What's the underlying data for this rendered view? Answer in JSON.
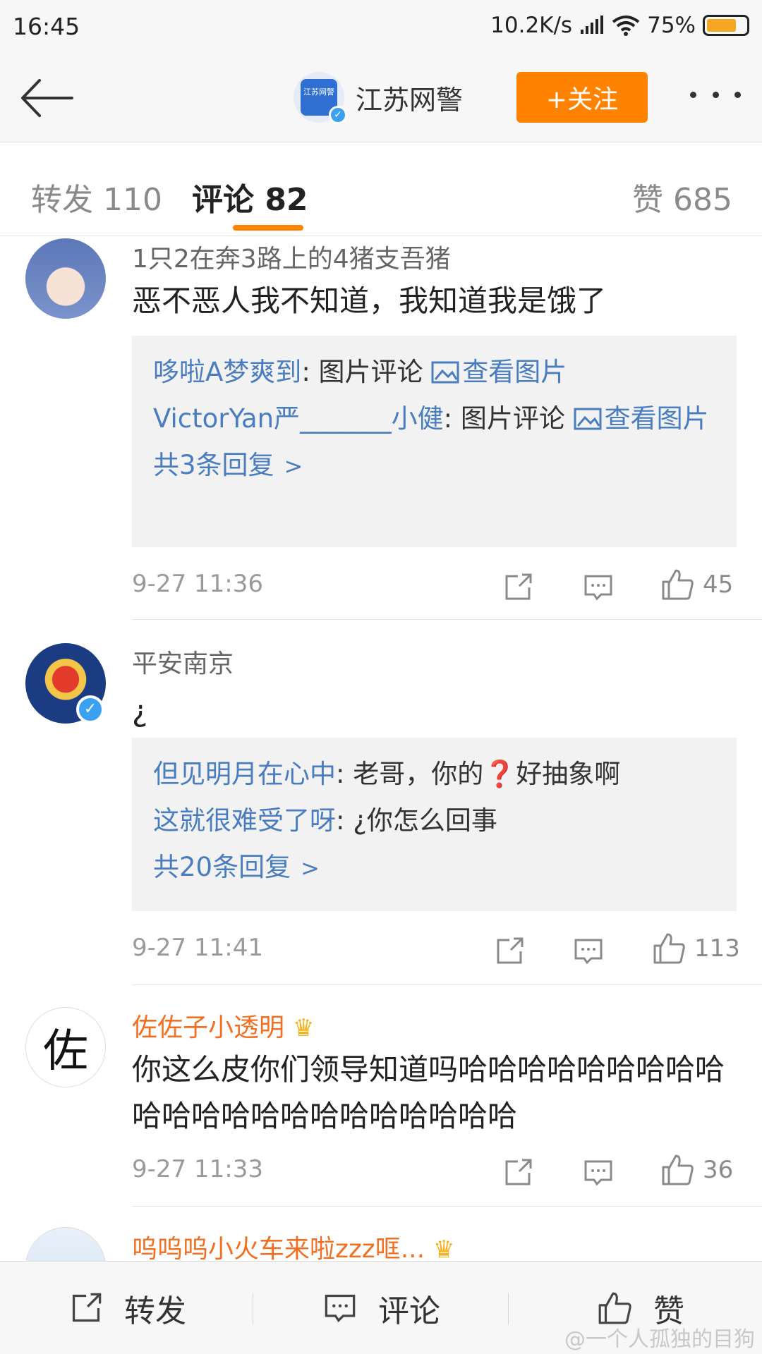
{
  "status_bar": {
    "time": "16:45",
    "network_speed": "10.2K/s",
    "battery": "75%",
    "icons": [
      "signal-icon",
      "wifi-icon",
      "battery-icon"
    ],
    "battery_level": 0.75
  },
  "header": {
    "account_name": "江苏网警",
    "avatar_text": "江苏网警",
    "follow_label": "+关注",
    "accent_color": "#ff8200"
  },
  "tabs": {
    "repost": "转发 110",
    "comment": "评论 82",
    "like": "赞 685"
  },
  "comments": [
    {
      "username": "1只2在奔3路上的4猪支吾猪",
      "content": "恶不恶人我不知道，我知道我是饿了",
      "replies": [
        {
          "user": "哆啦A梦爽到",
          "text": ": 图片评论 ",
          "link": "查看图片"
        },
        {
          "user": "VictorYan严_______小健",
          "text": ": 图片评论 ",
          "link": "查看图片"
        }
      ],
      "total_replies": "共3条回复",
      "time": "9-27 11:36",
      "likes": "45"
    },
    {
      "username": "平安南京",
      "content": "¿",
      "replies": [
        {
          "user": "但见明月在心中",
          "text": ": 老哥，你的❓好抽象啊"
        },
        {
          "user": "这就很难受了呀",
          "text": ": ¿你怎么回事"
        }
      ],
      "total_replies": "共20条回复",
      "time": "9-27 11:41",
      "likes": "113"
    },
    {
      "username": "佐佐子小透明",
      "avatar_char": "佐",
      "content": "你这么皮你们领导知道吗哈哈哈哈哈哈哈哈哈哈哈哈哈哈哈哈哈哈哈哈哈哈",
      "time": "9-27 11:33",
      "likes": "36"
    },
    {
      "username": "呜呜呜小火车来啦zzz哐..."
    }
  ],
  "bottom_bar": {
    "repost": "转发",
    "comment": "评论",
    "like": "赞"
  },
  "watermark": "@一个人孤独的目狗"
}
